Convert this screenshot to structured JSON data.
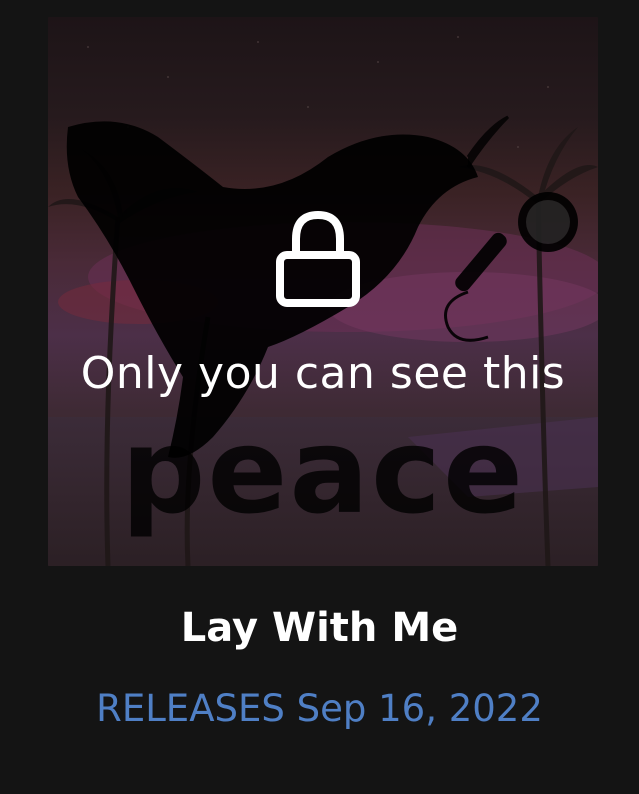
{
  "cover": {
    "artwork_text": "peace",
    "lock_icon": "lock-icon",
    "lock_message": "Only you can see this"
  },
  "release": {
    "title": "Lay With Me",
    "release_label": "RELEASES Sep 16, 2022"
  },
  "colors": {
    "background": "#141414",
    "title": "#ffffff",
    "release_date": "#4f7fc5",
    "overlay_text": "#ffffff"
  }
}
